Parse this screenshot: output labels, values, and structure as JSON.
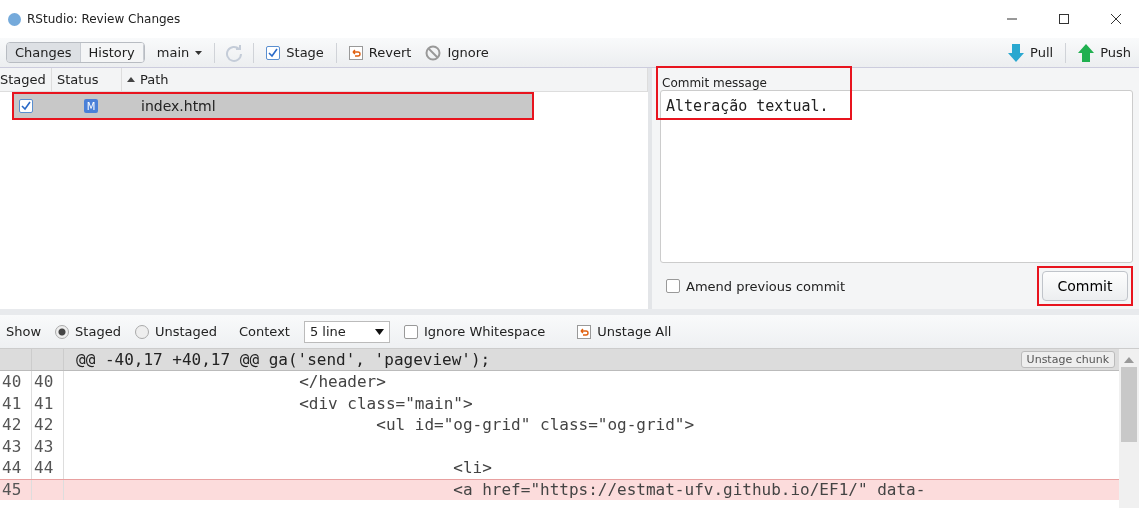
{
  "window": {
    "title": "RStudio: Review Changes"
  },
  "tabs": [
    {
      "label": "Changes",
      "selected": true
    },
    {
      "label": "History",
      "selected": false
    }
  ],
  "toolbar": {
    "branch": "main",
    "stage": {
      "label": "Stage",
      "checked": true
    },
    "revert": "Revert",
    "ignore": "Ignore",
    "pull": "Pull",
    "push": "Push"
  },
  "file_table": {
    "columns": [
      "Staged",
      "Status",
      "Path"
    ],
    "rows": [
      {
        "staged": true,
        "status": "M",
        "path": "index.html",
        "selected": true,
        "highlighted": true
      }
    ]
  },
  "commit": {
    "label": "Commit message",
    "value": "Alteração textual.",
    "highlighted": true,
    "amend": {
      "label": "Amend previous commit",
      "checked": false
    },
    "button": "Commit",
    "button_highlighted": true
  },
  "diff_toolbar": {
    "show_label": "Show",
    "options": [
      {
        "label": "Staged",
        "selected": true
      },
      {
        "label": "Unstaged",
        "selected": false
      }
    ],
    "context_label": "Context",
    "context_value": "5 line",
    "ignore_whitespace": {
      "label": "Ignore Whitespace",
      "checked": false
    },
    "unstage_all": "Unstage All"
  },
  "diff": {
    "header": "@@ -40,17 +40,17 @@ ga('send', 'pageview');",
    "chunk_button": "Unstage chunk",
    "lines": [
      {
        "old": "40",
        "new": "40",
        "kind": "context",
        "text": "                        </header>"
      },
      {
        "old": "41",
        "new": "41",
        "kind": "context",
        "text": "                        <div class=\"main\">"
      },
      {
        "old": "42",
        "new": "42",
        "kind": "context",
        "text": "                                <ul id=\"og-grid\" class=\"og-grid\">"
      },
      {
        "old": "43",
        "new": "43",
        "kind": "context"
      },
      {
        "old": "44",
        "new": "44",
        "kind": "context",
        "text": "                                        <li>"
      },
      {
        "old": "45",
        "kind": "removed",
        "text": "                                        <a href=\"https://estmat-ufv.github.io/EF1/\" data-"
      }
    ]
  }
}
